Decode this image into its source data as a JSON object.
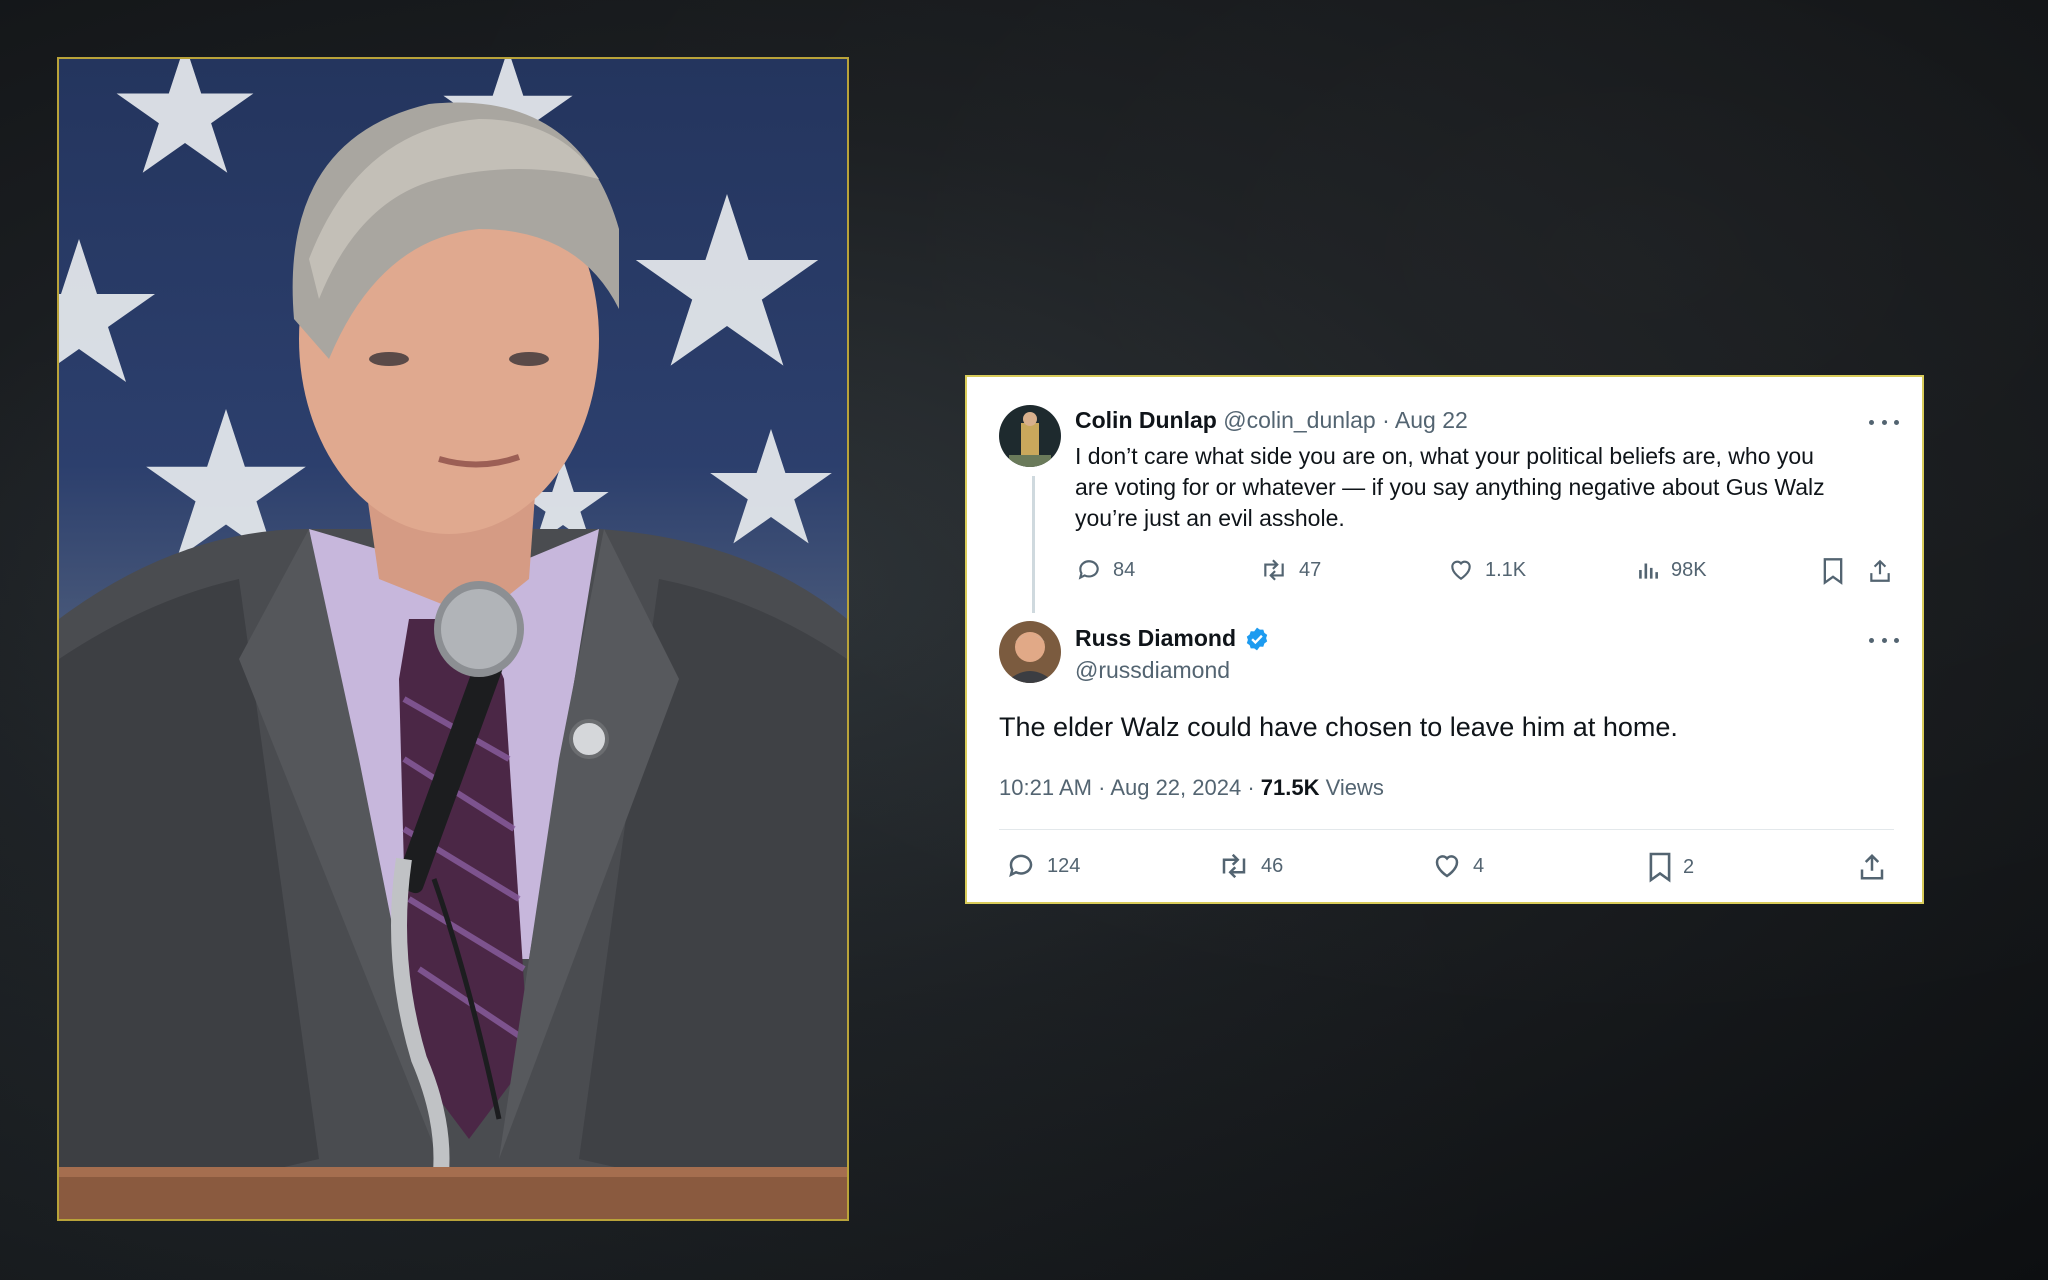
{
  "photo": {
    "subject": "man-speaking-at-podium"
  },
  "tweet_quoted": {
    "author_name": "Colin Dunlap",
    "author_handle": "@colin_dunlap",
    "separator": "·",
    "date": "Aug 22",
    "text_line1": "I don’t care what side you are on, what your political beliefs are, who you",
    "text_line2": "are voting for or whatever — if you say anything negative about Gus Walz",
    "text_line3": "you’re just an evil asshole.",
    "replies": "84",
    "retweets": "47",
    "likes": "1.1K",
    "views": "98K"
  },
  "tweet_main": {
    "author_name": "Russ Diamond",
    "author_handle": "@russdiamond",
    "text": "The elder Walz could have chosen to leave him at home.",
    "time": "10:21 AM",
    "date": "Aug 22, 2024",
    "separator": "·",
    "views_count": "71.5K",
    "views_label": "Views",
    "replies": "124",
    "retweets": "46",
    "likes": "4",
    "bookmarks": "2"
  },
  "colors": {
    "verified": "#1d9bf0",
    "text": "#0f1419",
    "muted": "#536471",
    "card_border": "#d9cc5a",
    "photo_border": "#b9a33a"
  }
}
